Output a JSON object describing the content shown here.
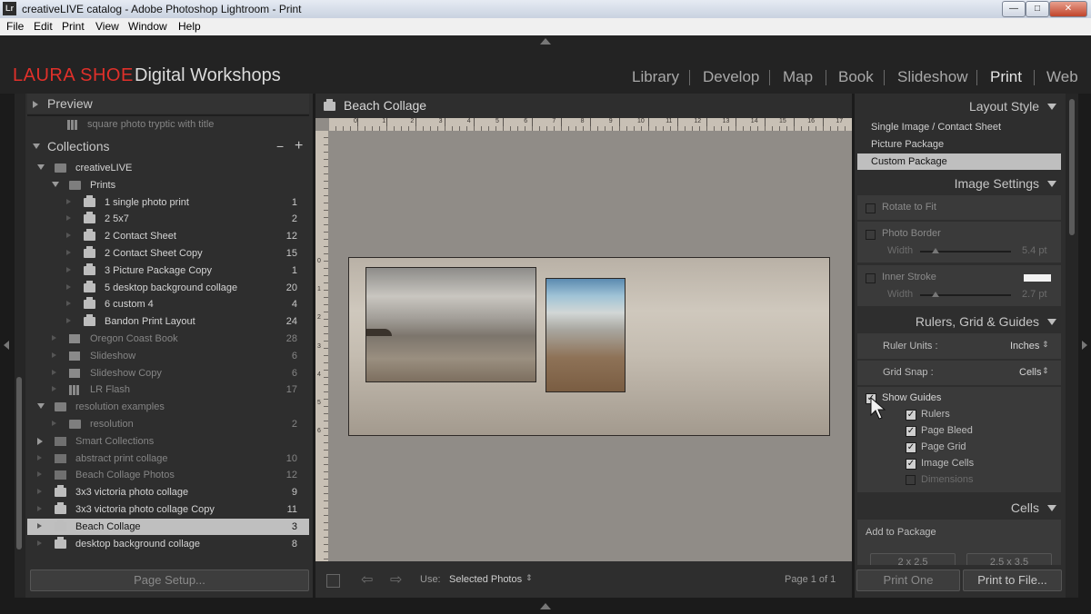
{
  "window": {
    "app_icon": "Lr",
    "title": "creativeLIVE catalog - Adobe Photoshop Lightroom - Print"
  },
  "menu": [
    "File",
    "Edit",
    "Print",
    "View",
    "Window",
    "Help"
  ],
  "brand": {
    "name_red": "LAURA SHOE",
    "name_white": "Digital Workshops"
  },
  "modules": [
    {
      "label": "Library"
    },
    {
      "label": "Develop"
    },
    {
      "label": "Map"
    },
    {
      "label": "Book"
    },
    {
      "label": "Slideshow"
    },
    {
      "label": "Print",
      "active": true
    },
    {
      "label": "Web"
    }
  ],
  "left": {
    "preview_label": "Preview",
    "partial_item": "square photo tryptic with title",
    "collections_label": "Collections",
    "collections_minus": "−",
    "collections_plus": "+",
    "rows": [
      {
        "label": "creativeLIVE",
        "count": "",
        "icon": "folder",
        "disc": "down",
        "indent": 0,
        "dim": false
      },
      {
        "label": "Prints",
        "count": "",
        "icon": "folder",
        "disc": "down",
        "indent": 1,
        "dim": false
      },
      {
        "label": "1 single photo print",
        "count": "1",
        "icon": "print",
        "disc": "rdim",
        "indent": 2,
        "dim": false
      },
      {
        "label": "2 5x7",
        "count": "2",
        "icon": "print",
        "disc": "rdim",
        "indent": 2,
        "dim": false
      },
      {
        "label": "2 Contact Sheet",
        "count": "12",
        "icon": "print",
        "disc": "rdim",
        "indent": 2,
        "dim": false
      },
      {
        "label": "2 Contact Sheet Copy",
        "count": "15",
        "icon": "print",
        "disc": "rdim",
        "indent": 2,
        "dim": false
      },
      {
        "label": "3 Picture Package Copy",
        "count": "1",
        "icon": "print",
        "disc": "rdim",
        "indent": 2,
        "dim": false
      },
      {
        "label": "5 desktop background collage",
        "count": "20",
        "icon": "print",
        "disc": "rdim",
        "indent": 2,
        "dim": false
      },
      {
        "label": "6 custom 4",
        "count": "4",
        "icon": "print",
        "disc": "rdim",
        "indent": 2,
        "dim": false
      },
      {
        "label": "Bandon Print Layout",
        "count": "24",
        "icon": "print",
        "disc": "rdim",
        "indent": 2,
        "dim": false
      },
      {
        "label": "Oregon Coast Book",
        "count": "28",
        "icon": "book",
        "disc": "rdim",
        "indent": 1,
        "dim": true
      },
      {
        "label": "Slideshow",
        "count": "6",
        "icon": "play",
        "disc": "rdim",
        "indent": 1,
        "dim": true
      },
      {
        "label": "Slideshow Copy",
        "count": "6",
        "icon": "play",
        "disc": "rdim",
        "indent": 1,
        "dim": true
      },
      {
        "label": "LR Flash",
        "count": "17",
        "icon": "grid",
        "disc": "rdim",
        "indent": 1,
        "dim": true
      },
      {
        "label": "resolution examples",
        "count": "",
        "icon": "folder",
        "disc": "down",
        "indent": 0,
        "dim": true
      },
      {
        "label": "resolution",
        "count": "2",
        "icon": "folder",
        "disc": "rdim",
        "indent": 1,
        "dim": true
      },
      {
        "label": "Smart Collections",
        "count": "",
        "icon": "smart",
        "disc": "right",
        "indent": 0,
        "dim": true
      },
      {
        "label": "abstract print collage",
        "count": "10",
        "icon": "smart",
        "disc": "rdim",
        "indent": 0,
        "dim": true
      },
      {
        "label": "Beach Collage Photos",
        "count": "12",
        "icon": "smart",
        "disc": "rdim",
        "indent": 0,
        "dim": true
      },
      {
        "label": "3x3 victoria photo collage",
        "count": "9",
        "icon": "print",
        "disc": "rdim",
        "indent": 0,
        "dim": false
      },
      {
        "label": "3x3 victoria photo collage Copy",
        "count": "11",
        "icon": "print",
        "disc": "rdim",
        "indent": 0,
        "dim": false
      },
      {
        "label": "Beach Collage",
        "count": "3",
        "icon": "print",
        "disc": "rdim",
        "indent": 0,
        "dim": false,
        "selected": true
      },
      {
        "label": "desktop background collage",
        "count": "8",
        "icon": "print",
        "disc": "rdim",
        "indent": 0,
        "dim": false
      }
    ],
    "page_setup_label": "Page Setup..."
  },
  "center": {
    "title": "Beach Collage",
    "ruler_labels": [
      "0",
      "1",
      "2",
      "3",
      "4",
      "5",
      "6",
      "7",
      "8",
      "9",
      "10",
      "11",
      "12",
      "13",
      "14",
      "15",
      "16",
      "17"
    ],
    "left_ruler_labels": [
      "0",
      "1",
      "2",
      "3",
      "4",
      "5",
      "6"
    ],
    "use_label": "Use:",
    "use_value": "Selected Photos",
    "page_info": "Page 1 of 1"
  },
  "right": {
    "layout_style": {
      "title": "Layout Style",
      "items": [
        {
          "label": "Single Image / Contact Sheet"
        },
        {
          "label": "Picture Package"
        },
        {
          "label": "Custom Package",
          "selected": true
        }
      ]
    },
    "image_settings": {
      "title": "Image Settings",
      "rotate_to_fit": "Rotate to Fit",
      "photo_border": "Photo Border",
      "width_label": "Width",
      "photo_border_width": "5.4 pt",
      "inner_stroke": "Inner Stroke",
      "inner_stroke_width": "2.7 pt",
      "inner_stroke_color": "#f2f2f2"
    },
    "rulers": {
      "title": "Rulers, Grid & Guides",
      "ruler_units_label": "Ruler Units :",
      "ruler_units_value": "Inches",
      "grid_snap_label": "Grid Snap :",
      "grid_snap_value": "Cells",
      "show_guides": "Show Guides",
      "guides": [
        {
          "label": "Rulers",
          "checked": true
        },
        {
          "label": "Page Bleed",
          "checked": true
        },
        {
          "label": "Page Grid",
          "checked": true
        },
        {
          "label": "Image Cells",
          "checked": true
        },
        {
          "label": "Dimensions",
          "checked": false
        }
      ]
    },
    "cells": {
      "title": "Cells",
      "add_to_package": "Add to Package",
      "size_buttons": [
        "2 x 2.5",
        "2.5 x 3.5"
      ]
    },
    "print_one_label": "Print One",
    "print_to_file_label": "Print to File..."
  },
  "colors": {
    "accent_red": "#e0302a",
    "panel_bg": "#2e2e2e",
    "canvas_bg": "#908c87"
  }
}
